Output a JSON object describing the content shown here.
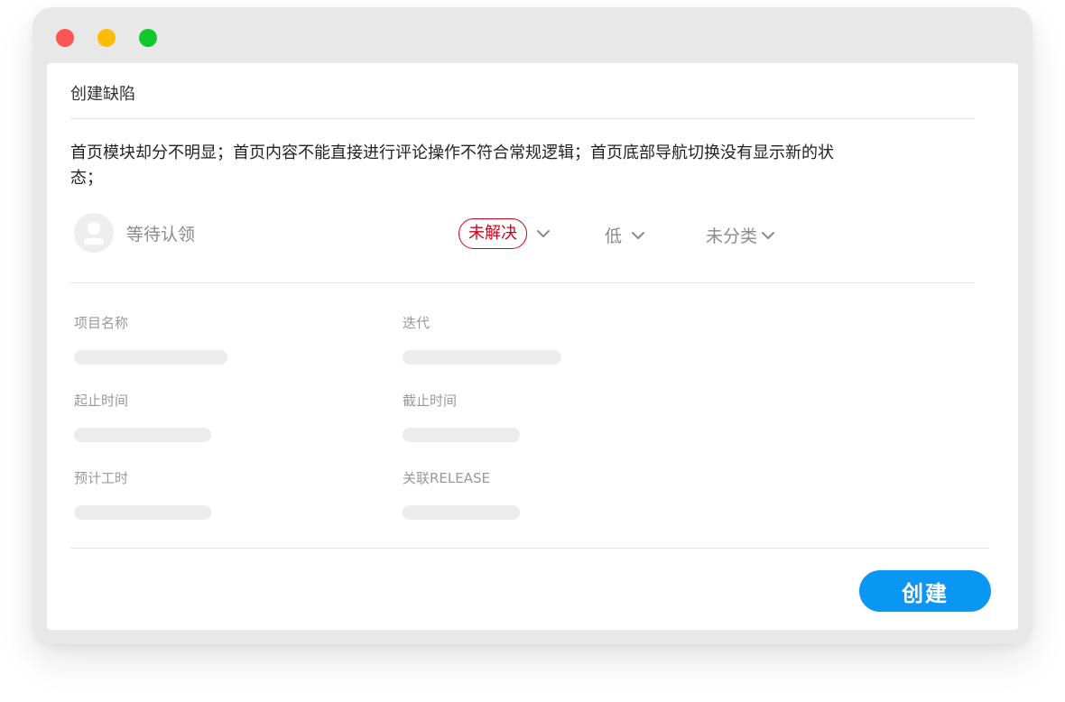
{
  "dialog": {
    "title": "创建缺陷"
  },
  "issue": {
    "description": "首页模块却分不明显；首页内容不能直接进行评论操作不符合常规逻辑；首页底部导航切换没有显示新的状态；"
  },
  "assignee": {
    "label": "等待认领"
  },
  "status": {
    "label": "未解决",
    "color": "#d0021b"
  },
  "priority": {
    "label": "低"
  },
  "category": {
    "label": "未分类"
  },
  "fields": {
    "project_name": "项目名称",
    "iteration": "迭代",
    "start_time": "起止时间",
    "deadline": "截止时间",
    "estimated_hours": "预计工时",
    "linked_release": "关联RELEASE"
  },
  "actions": {
    "create_label": "创建",
    "create_color": "#0a96f3"
  },
  "window": {
    "controls": [
      "close",
      "minimize",
      "maximize"
    ]
  }
}
